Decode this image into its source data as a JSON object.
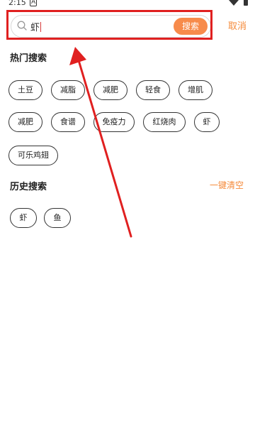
{
  "status": {
    "time": "2:15",
    "indicator": "A"
  },
  "search": {
    "value": "虾",
    "button_label": "搜索",
    "cancel_label": "取消"
  },
  "hot": {
    "title": "热门搜索",
    "tags": [
      "土豆",
      "减脂",
      "减肥",
      "轻食",
      "增肌",
      "减肥",
      "食谱",
      "免疫力",
      "红烧肉",
      "虾",
      "可乐鸡翅"
    ]
  },
  "history": {
    "title": "历史搜索",
    "clear_label": "一键清空",
    "tags": [
      "虾",
      "鱼"
    ]
  },
  "colors": {
    "accent": "#f78b4b",
    "annotation": "#e02020"
  }
}
